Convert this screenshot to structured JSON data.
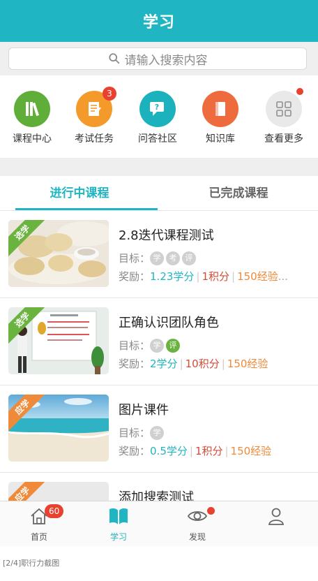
{
  "header": {
    "title": "学习"
  },
  "search": {
    "placeholder": "请输入搜索内容"
  },
  "quick_links": [
    {
      "label": "课程中心",
      "icon": "books-icon",
      "color": "#5fae3a"
    },
    {
      "label": "考试任务",
      "icon": "exam-paper-icon",
      "color": "#f39a2b",
      "badge": "3"
    },
    {
      "label": "问答社区",
      "icon": "qa-chat-icon",
      "color": "#1bb1bd"
    },
    {
      "label": "知识库",
      "icon": "knowledge-book-icon",
      "color": "#ee6b3d"
    },
    {
      "label": "查看更多",
      "icon": "grid-more-icon",
      "color": "#e9e9e9",
      "dot": true
    }
  ],
  "tabs": [
    {
      "label": "进行中课程",
      "active": true
    },
    {
      "label": "已完成课程",
      "active": false
    }
  ],
  "courses": [
    {
      "ribbon": "选学",
      "title": "2.8迭代课程测试",
      "goal_label": "目标：",
      "goals": [
        {
          "text": "学",
          "on": false
        },
        {
          "text": "考",
          "on": false
        },
        {
          "text": "评",
          "on": false
        }
      ],
      "reward_label": "奖励：",
      "credit": "1.23学分",
      "points": "1积分",
      "exp": "150经验",
      "more": "..."
    },
    {
      "ribbon": "选学",
      "title": "正确认识团队角色",
      "goal_label": "目标：",
      "goals": [
        {
          "text": "学",
          "on": false
        },
        {
          "text": "评",
          "on": true
        }
      ],
      "reward_label": "奖励：",
      "credit": "2学分",
      "points": "10积分",
      "exp": "150经验"
    },
    {
      "ribbon": "应学",
      "title": "图片课件",
      "goal_label": "目标：",
      "goals": [
        {
          "text": "学",
          "on": false
        }
      ],
      "reward_label": "奖励：",
      "credit": "0.5学分",
      "points": "1积分",
      "exp": "150经验"
    },
    {
      "ribbon": "应学",
      "title": "添加搜索测试"
    }
  ],
  "bottom_nav": [
    {
      "label": "首页",
      "icon": "home-icon",
      "badge": "60"
    },
    {
      "label": "学习",
      "icon": "open-book-icon",
      "active": true
    },
    {
      "label": "发现",
      "icon": "eye-icon",
      "dot": true
    },
    {
      "label": "",
      "icon": "user-icon"
    }
  ],
  "caption": "[2/4]职行力截图",
  "colors": {
    "accent": "#20b5c2",
    "badge": "#e8412f",
    "credit": "#20b5c2",
    "points": "#d24b34",
    "exp": "#ee8a3a"
  }
}
